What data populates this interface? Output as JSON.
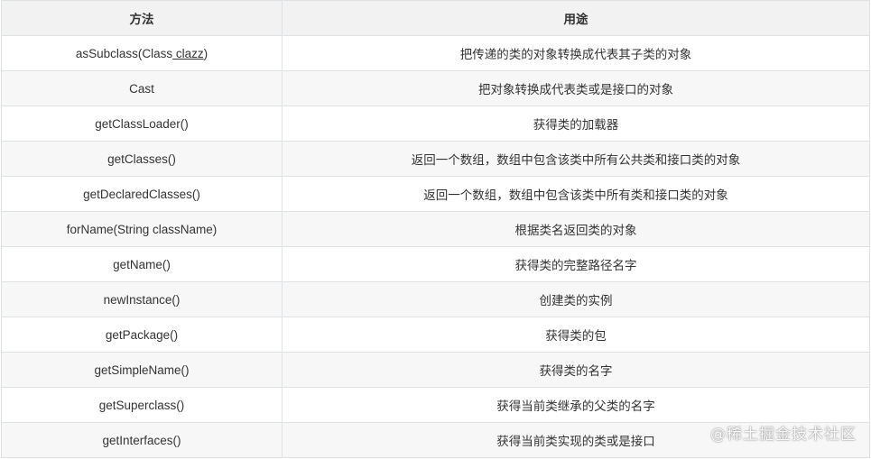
{
  "table": {
    "headers": [
      "方法",
      "用途"
    ],
    "rows": [
      {
        "method_pre": "asSubclass(Class",
        "method_u": " clazz",
        "method_post": ")",
        "use": "把传递的类的对象转换成代表其子类的对象"
      },
      {
        "method": "Cast",
        "use": "把对象转换成代表类或是接口的对象"
      },
      {
        "method": "getClassLoader()",
        "use": "获得类的加载器"
      },
      {
        "method": "getClasses()",
        "use": "返回一个数组，数组中包含该类中所有公共类和接口类的对象"
      },
      {
        "method": "getDeclaredClasses()",
        "use": "返回一个数组，数组中包含该类中所有类和接口类的对象"
      },
      {
        "method": "forName(String className)",
        "use": "根据类名返回类的对象"
      },
      {
        "method": "getName()",
        "use": "获得类的完整路径名字"
      },
      {
        "method": "newInstance()",
        "use": "创建类的实例"
      },
      {
        "method": "getPackage()",
        "use": "获得类的包"
      },
      {
        "method": "getSimpleName()",
        "use": "获得类的名字"
      },
      {
        "method": "getSuperclass()",
        "use": "获得当前类继承的父类的名字"
      },
      {
        "method": "getInterfaces()",
        "use": "获得当前类实现的类或是接口"
      }
    ]
  },
  "watermark": "@稀土掘金技术社区"
}
